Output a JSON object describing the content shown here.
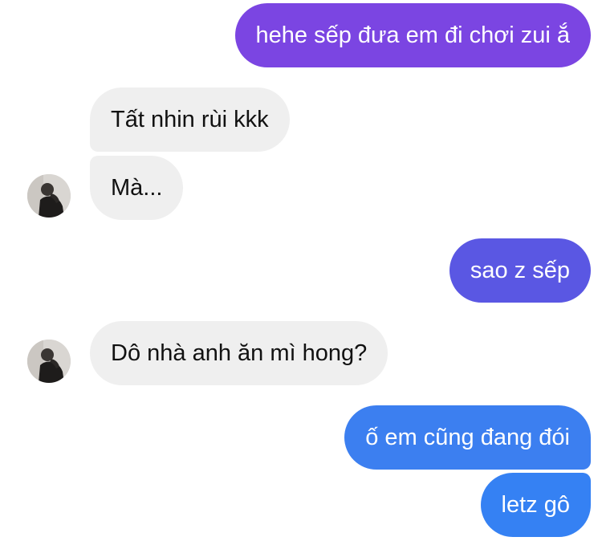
{
  "messages": [
    {
      "from": "me",
      "text": "hehe sếp đưa em đi chơi zui ắ",
      "color": "#7b45e2"
    },
    {
      "from": "them",
      "text": "Tất nhin rùi kkk"
    },
    {
      "from": "them",
      "text": "Mà..."
    },
    {
      "from": "me",
      "text": "sao z sếp",
      "color": "#5a57e3"
    },
    {
      "from": "them",
      "text": "Dô nhà anh ăn mì hong?"
    },
    {
      "from": "me",
      "text": "ố em cũng đang đói",
      "color": "#3c7ff0"
    },
    {
      "from": "me",
      "text": "letz gô",
      "color": "#3581f3"
    }
  ],
  "avatar": {
    "icon": "contact-avatar-icon"
  },
  "colors": {
    "incoming_bubble": "#efefef",
    "incoming_text": "#111111",
    "outgoing_text": "#ffffff",
    "background": "#ffffff"
  }
}
